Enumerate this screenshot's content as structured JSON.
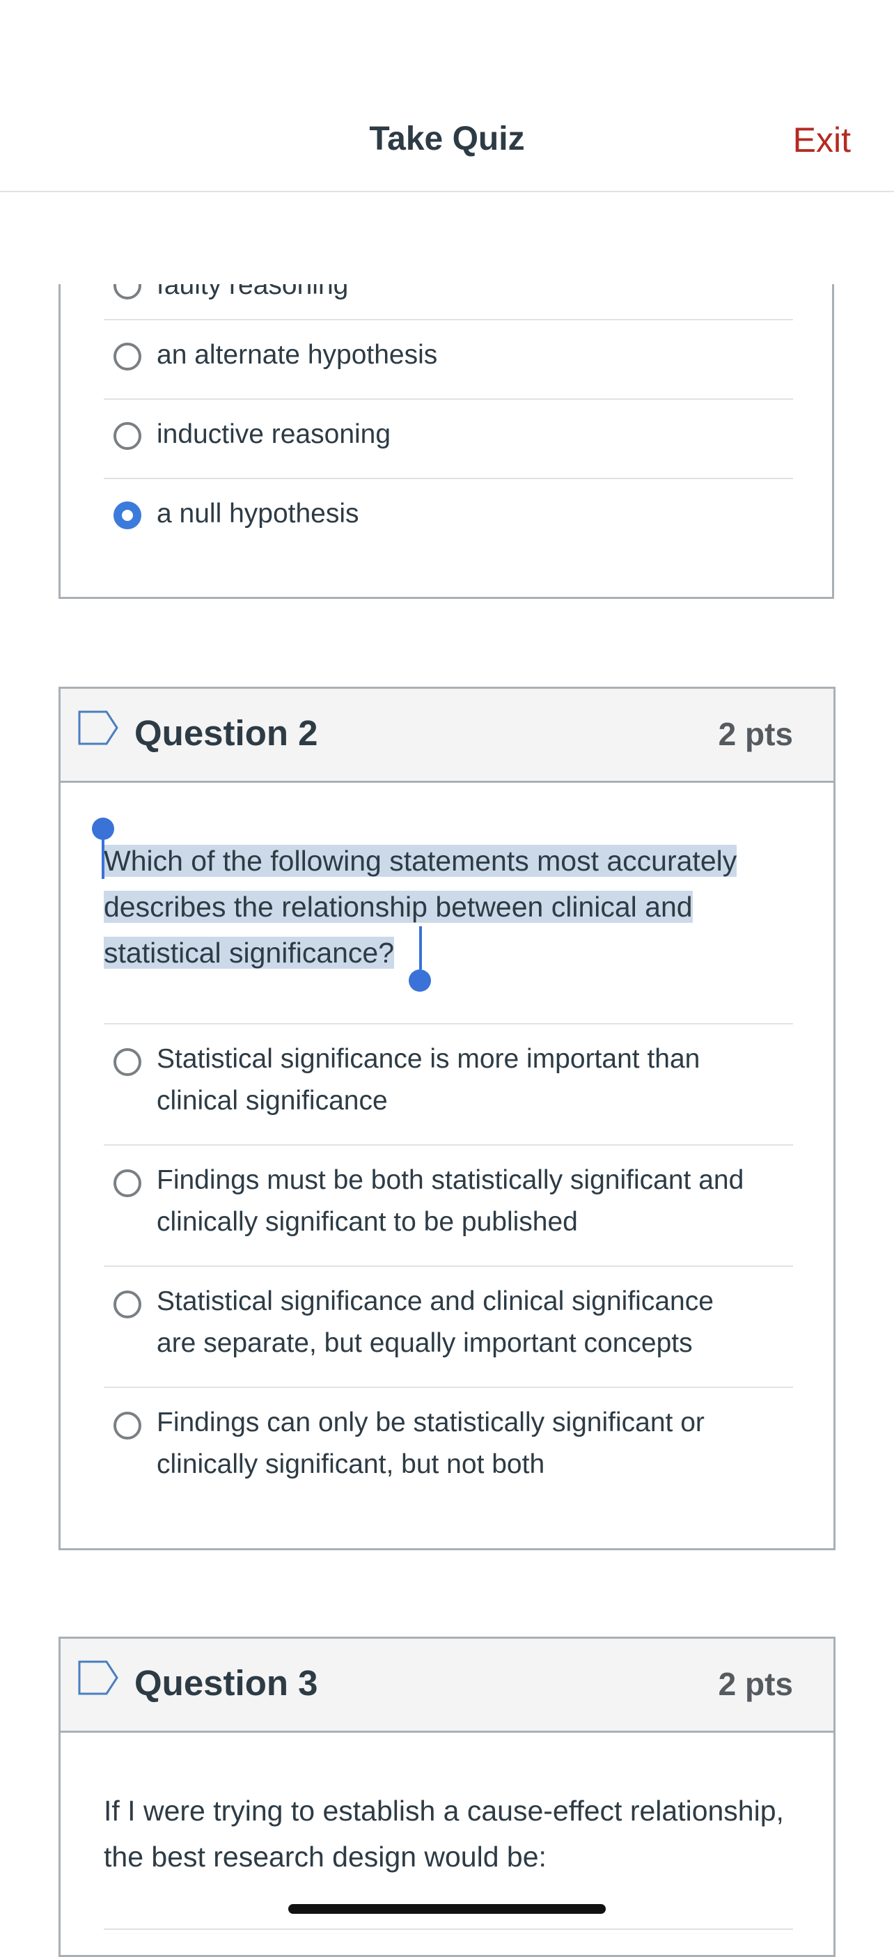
{
  "header": {
    "title": "Take Quiz",
    "exit_label": "Exit"
  },
  "question1": {
    "partial_answer": "faulty reasoning",
    "answers": [
      {
        "label": "an alternate hypothesis",
        "selected": false
      },
      {
        "label": "inductive reasoning",
        "selected": false
      },
      {
        "label": "a null hypothesis",
        "selected": true
      }
    ]
  },
  "question2": {
    "title": "Question 2",
    "points": "2 pts",
    "text": "Which of the following statements most accurately describes the relationship between clinical and statistical significance?",
    "answers": [
      {
        "line1": "Statistical significance is more important than",
        "line2": "clinical significance"
      },
      {
        "line1": "Findings must be both statistically significant and",
        "line2": "clinically significant to be published"
      },
      {
        "line1": "Statistical significance and clinical significance",
        "line2": "are separate, but equally important concepts"
      },
      {
        "line1": "Findings can only be statistically significant or",
        "line2": "clinically significant, but not both"
      }
    ]
  },
  "question3": {
    "title": "Question 3",
    "points": "2 pts",
    "text": "If I were trying to establish a cause-effect relationship, the best research design would be:"
  },
  "colors": {
    "accent": "#3b7bdb",
    "exit": "#b52a22",
    "highlight": "#ccd9e9"
  }
}
